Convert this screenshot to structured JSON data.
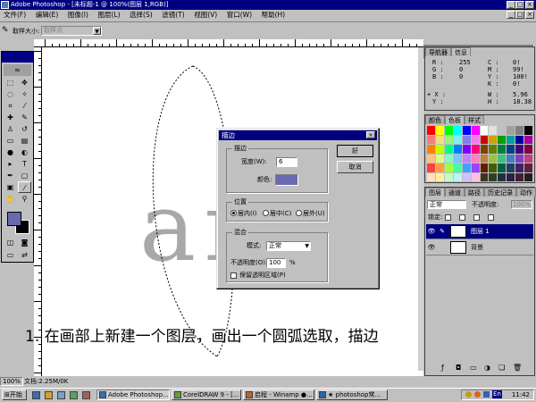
{
  "window": {
    "title": "Adobe Photoshop - [未标题-1 @ 100%(图层 1,RGB)]",
    "controls": [
      "_",
      "□",
      "×"
    ]
  },
  "menu": [
    "文件(F)",
    "编辑(E)",
    "图像(I)",
    "图层(L)",
    "选择(S)",
    "滤镜(T)",
    "视图(V)",
    "窗口(W)",
    "帮助(H)"
  ],
  "options": {
    "label": "取样大小:",
    "value": "取样点"
  },
  "canvas": {
    "art_text": "artc",
    "caption": "1. 在画部上新建一个图层，画出一个圆弧选取，描边"
  },
  "status": {
    "zoom": "100%",
    "doc": "文档:2.25M/0K"
  },
  "panels": {
    "nav_tabs": [
      "导航器",
      "信息"
    ],
    "info": {
      "r_label": "R :",
      "r": "255",
      "g_label": "G :",
      "g": "0",
      "b_label": "B :",
      "b": "0",
      "c_label": "C :",
      "c": "0!",
      "m_label": "M :",
      "m": "99!",
      "y_label": "Y :",
      "y": "100!",
      "k_label": "K :",
      "k": "0!",
      "x_label": "+ X :",
      "x": "",
      "yy_label": "Y :",
      "yy": "",
      "w_label": "W :",
      "w": "5.96",
      "h_label": "H :",
      "h": "18.38"
    },
    "color_tabs": [
      "颜色",
      "色板",
      "样式"
    ],
    "layer_tabs": [
      "图层",
      "通道",
      "路径",
      "历史记录",
      "动作"
    ],
    "blend_mode": "正常",
    "opacity_label": "不透明度:",
    "opacity": "100%",
    "lock_label": "锁定:",
    "layers": [
      {
        "name": "图层 1",
        "active": true
      },
      {
        "name": "背景",
        "active": false
      }
    ]
  },
  "dialog": {
    "title": "描边",
    "stroke_group": "描边",
    "width_label": "宽度(W):",
    "width_value": "6",
    "color_label": "颜色:",
    "position_group": "位置",
    "pos_inside": "居内(I)",
    "pos_center": "居中(C)",
    "pos_outside": "居外(U)",
    "blend_group": "混合",
    "mode_label": "模式:",
    "mode_value": "正常",
    "opacity_label": "不透明度(O):",
    "opacity_value": "100",
    "opacity_unit": "%",
    "preserve_label": "保留透明区域(P)",
    "ok": "好",
    "cancel": "取消"
  },
  "taskbar": {
    "start": "开始",
    "tasks": [
      "Adobe Photoshop...",
      "CorelDRAW 9 - [...",
      "启程 - Winamp ●...",
      "★ photoshop常..."
    ],
    "time": "11:42",
    "lang": "En"
  },
  "colors": {
    "titlebar": "#000080",
    "stroke_color": "#6a6ab0",
    "selected_layer": "#000080"
  }
}
